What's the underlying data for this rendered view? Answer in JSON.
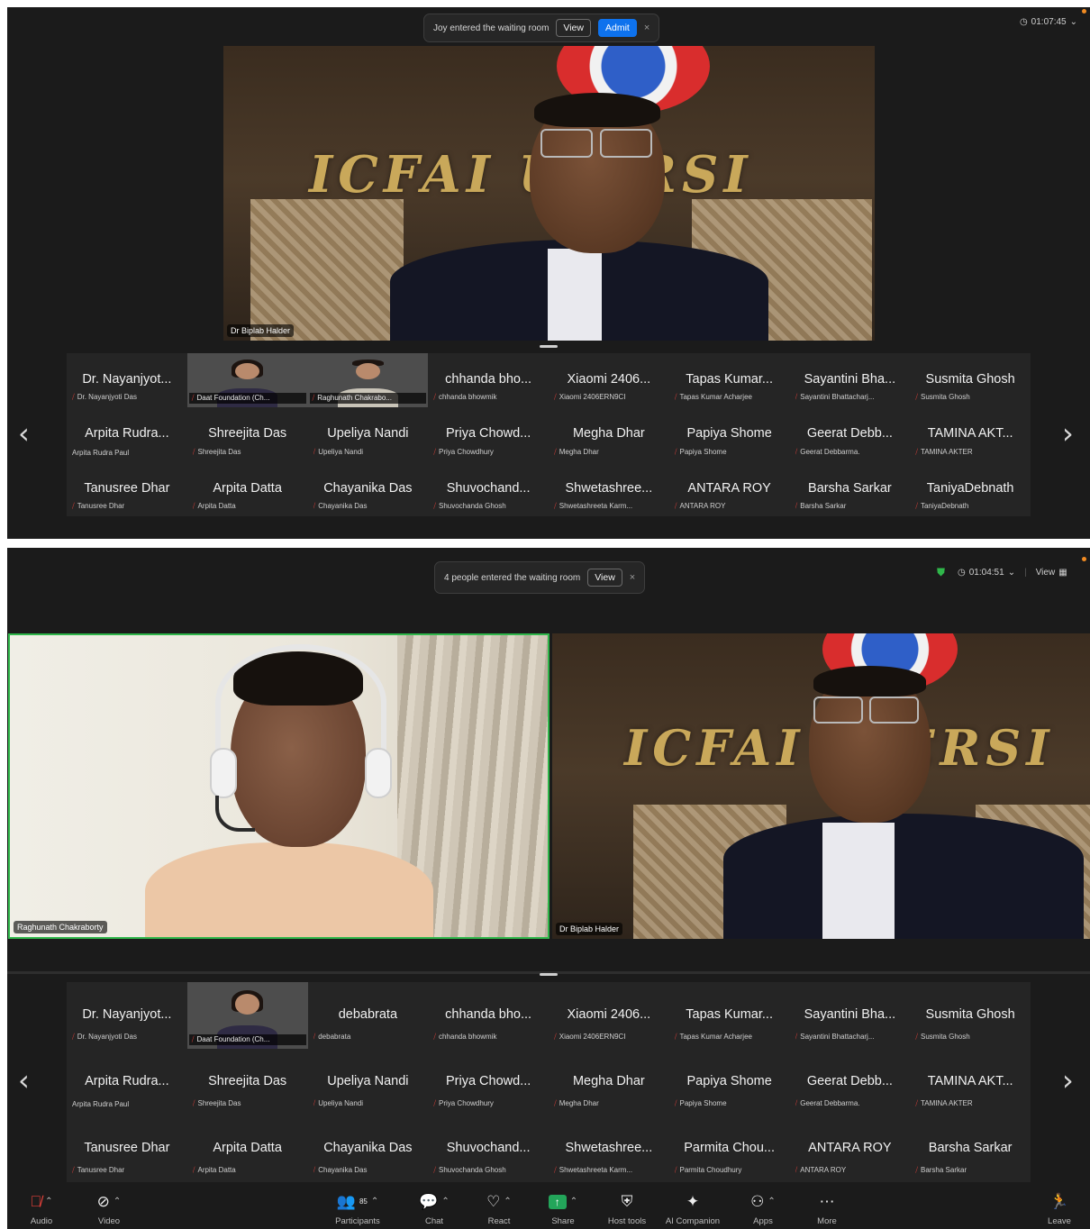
{
  "window1": {
    "notification": {
      "text": "Joy entered the waiting room",
      "view_label": "View",
      "admit_label": "Admit",
      "close": "×"
    },
    "timer": "01:07:45",
    "speaker_name": "Dr Biplab Halder",
    "wall_text": "ICFAI U  ERSI",
    "gallery": [
      {
        "big": "Dr. Nayanjyot...",
        "small": "Dr. Nayanjyoti Das"
      },
      {
        "thumb": "woman",
        "small": "Daat Foundation (Ch..."
      },
      {
        "thumb": "man",
        "small": "Raghunath Chakrabo..."
      },
      {
        "big": "chhanda bho...",
        "small": "chhanda bhowmik"
      },
      {
        "big": "Xiaomi 2406...",
        "small": "Xiaomi 2406ERN9CI"
      },
      {
        "big": "Tapas Kumar...",
        "small": "Tapas Kumar Acharjee"
      },
      {
        "big": "Sayantini Bha...",
        "small": "Sayantini Bhattacharj..."
      },
      {
        "big": "Susmita Ghosh",
        "small": "Susmita Ghosh"
      },
      {
        "big": "Arpita Rudra...",
        "small": "Arpita Rudra Paul",
        "nomute": true
      },
      {
        "big": "Shreejita Das",
        "small": "Shreejita Das"
      },
      {
        "big": "Upeliya Nandi",
        "small": "Upeliya Nandi"
      },
      {
        "big": "Priya Chowd...",
        "small": "Priya Chowdhury"
      },
      {
        "big": "Megha Dhar",
        "small": "Megha Dhar"
      },
      {
        "big": "Papiya Shome",
        "small": "Papiya Shome"
      },
      {
        "big": "Geerat Debb...",
        "small": "Geerat Debbarma."
      },
      {
        "big": "TAMINA AKT...",
        "small": "TAMINA AKTER"
      },
      {
        "big": "Tanusree Dhar",
        "small": "Tanusree Dhar"
      },
      {
        "big": "Arpita Datta",
        "small": "Arpita Datta"
      },
      {
        "big": "Chayanika Das",
        "small": "Chayanika Das"
      },
      {
        "big": "Shuvochand...",
        "small": "Shuvochanda Ghosh"
      },
      {
        "big": "Shwetashree...",
        "small": "Shwetashreeta Karm..."
      },
      {
        "big": "ANTARA ROY",
        "small": "ANTARA ROY"
      },
      {
        "big": "Barsha Sarkar",
        "small": "Barsha Sarkar"
      },
      {
        "big": "TaniyaDebnath",
        "small": "TaniyaDebnath"
      }
    ]
  },
  "window2": {
    "notification": {
      "text": "4 people entered the waiting room",
      "view_label": "View",
      "close": "×"
    },
    "timer": "01:04:51",
    "view_label": "View",
    "left_video_name": "Raghunath Chakraborty",
    "right_video_name": "Dr Biplab Halder",
    "wall_text": "ICFAI U  ERSI",
    "gallery": [
      {
        "big": "Dr. Nayanjyot...",
        "small": "Dr. Nayanjyoti Das"
      },
      {
        "thumb": "woman",
        "small": "Daat Foundation (Ch..."
      },
      {
        "big": "debabrata",
        "small": "debabrata"
      },
      {
        "big": "chhanda bho...",
        "small": "chhanda bhowmik"
      },
      {
        "big": "Xiaomi 2406...",
        "small": "Xiaomi 2406ERN9CI"
      },
      {
        "big": "Tapas Kumar...",
        "small": "Tapas Kumar Acharjee"
      },
      {
        "big": "Sayantini Bha...",
        "small": "Sayantini Bhattacharj..."
      },
      {
        "big": "Susmita Ghosh",
        "small": "Susmita Ghosh"
      },
      {
        "big": "Arpita Rudra...",
        "small": "Arpita Rudra Paul",
        "nomute": true
      },
      {
        "big": "Shreejita Das",
        "small": "Shreejita Das"
      },
      {
        "big": "Upeliya Nandi",
        "small": "Upeliya Nandi"
      },
      {
        "big": "Priya Chowd...",
        "small": "Priya Chowdhury"
      },
      {
        "big": "Megha Dhar",
        "small": "Megha Dhar"
      },
      {
        "big": "Papiya Shome",
        "small": "Papiya Shome"
      },
      {
        "big": "Geerat Debb...",
        "small": "Geerat Debbarma."
      },
      {
        "big": "TAMINA AKT...",
        "small": "TAMINA AKTER"
      },
      {
        "big": "Tanusree Dhar",
        "small": "Tanusree Dhar"
      },
      {
        "big": "Arpita Datta",
        "small": "Arpita Datta"
      },
      {
        "big": "Chayanika Das",
        "small": "Chayanika Das"
      },
      {
        "big": "Shuvochand...",
        "small": "Shuvochanda Ghosh"
      },
      {
        "big": "Shwetashree...",
        "small": "Shwetashreeta Karm..."
      },
      {
        "big": "Parmita Chou...",
        "small": "Parmita Choudhury"
      },
      {
        "big": "ANTARA ROY",
        "small": "ANTARA ROY"
      },
      {
        "big": "Barsha Sarkar",
        "small": "Barsha Sarkar"
      }
    ],
    "toolbar": {
      "audio": "Audio",
      "video": "Video",
      "participants": "Participants",
      "participants_count": "85",
      "chat": "Chat",
      "react": "React",
      "share": "Share",
      "host_tools": "Host tools",
      "ai_companion": "AI Companion",
      "apps": "Apps",
      "more": "More",
      "leave": "Leave"
    }
  },
  "colors": {
    "panel_bg": "#1b1b1b",
    "strip_bg": "#252525",
    "admit_blue": "#0e72ed",
    "active_speaker_border": "#2fb64a",
    "mute_red": "#e5413a",
    "share_green": "#23a55a"
  },
  "icons": [
    "clock-icon",
    "chevron-down-icon",
    "shield-check-icon",
    "grid-icon",
    "mic-muted-icon",
    "video-off-icon",
    "participants-icon",
    "chat-icon",
    "react-icon",
    "share-icon",
    "host-tools-icon",
    "ai-companion-icon",
    "apps-icon",
    "more-icon",
    "leave-icon"
  ]
}
